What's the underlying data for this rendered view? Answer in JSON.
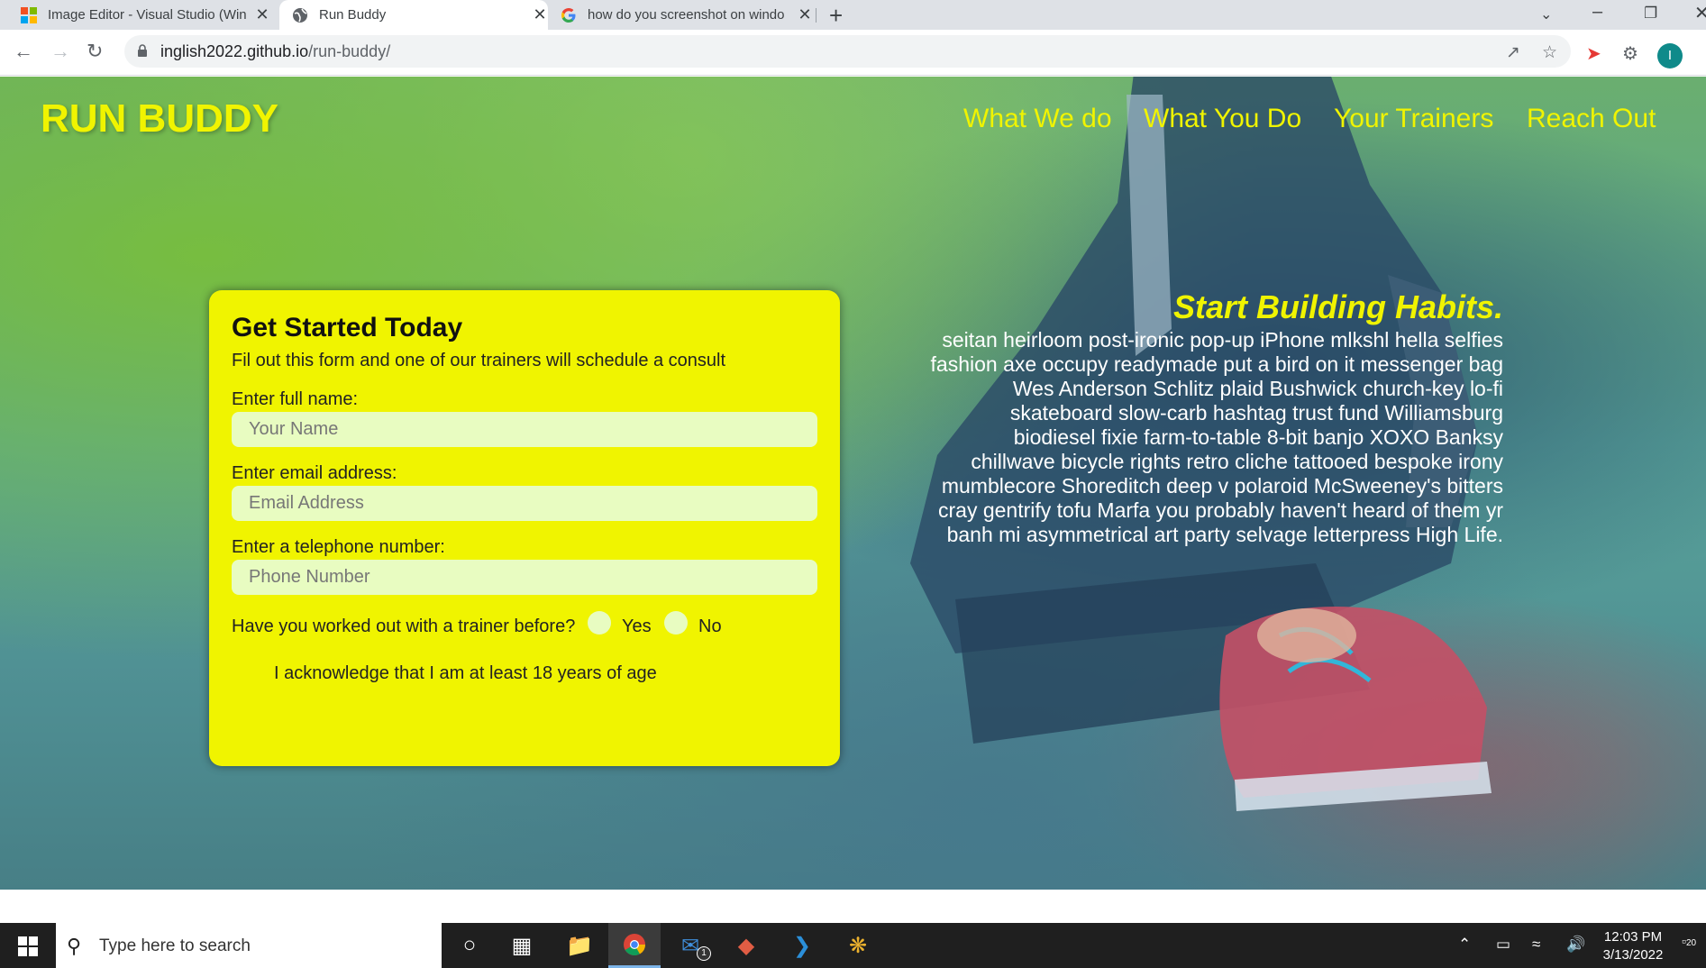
{
  "browser": {
    "tabs": [
      {
        "title": "Image Editor - Visual Studio (Win",
        "close": "✕",
        "icon": "microsoft-logo-icon"
      },
      {
        "title": "Run Buddy",
        "close": "✕",
        "icon": "globe-icon"
      },
      {
        "title": "how do you screenshot on windo",
        "close": "✕",
        "icon": "google-logo-icon"
      }
    ],
    "new_tab": "+",
    "url_host": "inglish2022.github.io",
    "url_path": "/run-buddy/",
    "profile_initial": "I"
  },
  "page": {
    "brand": "RUN BUDDY",
    "nav": [
      "What We do",
      "What You Do",
      "Your Trainers",
      "Reach Out"
    ],
    "form": {
      "heading": "Get Started Today",
      "subheading": "Fil out this form and one of our trainers will schedule a consult",
      "name_label": "Enter full name:",
      "name_placeholder": "Your Name",
      "email_label": "Enter email address:",
      "email_placeholder": "Email Address",
      "phone_label": "Enter a telephone number:",
      "phone_placeholder": "Phone Number",
      "trainer_question": "Have you worked out with a trainer before?",
      "yes_label": "Yes",
      "no_label": "No",
      "acknowledge": "I acknowledge that I am at least 18 years of age"
    },
    "habits": {
      "heading": "Start Building Habits.",
      "body": "seitan heirloom post-ironic pop-up iPhone mlkshl hella selfies fashion axe occupy readymade put a bird on it messenger bag Wes Anderson Schlitz plaid Bushwick church-key lo-fi skateboard slow-carb hashtag trust fund Williamsburg biodiesel fixie farm-to-table 8-bit banjo XOXO Banksy chillwave bicycle rights retro cliche tattooed bespoke irony mumblecore Shoreditch deep v polaroid McSweeney's bitters cray gentrify tofu Marfa you probably haven't heard of them yr banh mi asymmetrical art party selvage letterpress High Life."
    },
    "colors": {
      "accent": "#f0f400",
      "input_bg": "#e8fcc1"
    }
  },
  "taskbar": {
    "search_placeholder": "Type here to search",
    "mail_badge": "1",
    "time": "12:03 PM",
    "date": "3/13/2022",
    "notification_count": "20"
  }
}
